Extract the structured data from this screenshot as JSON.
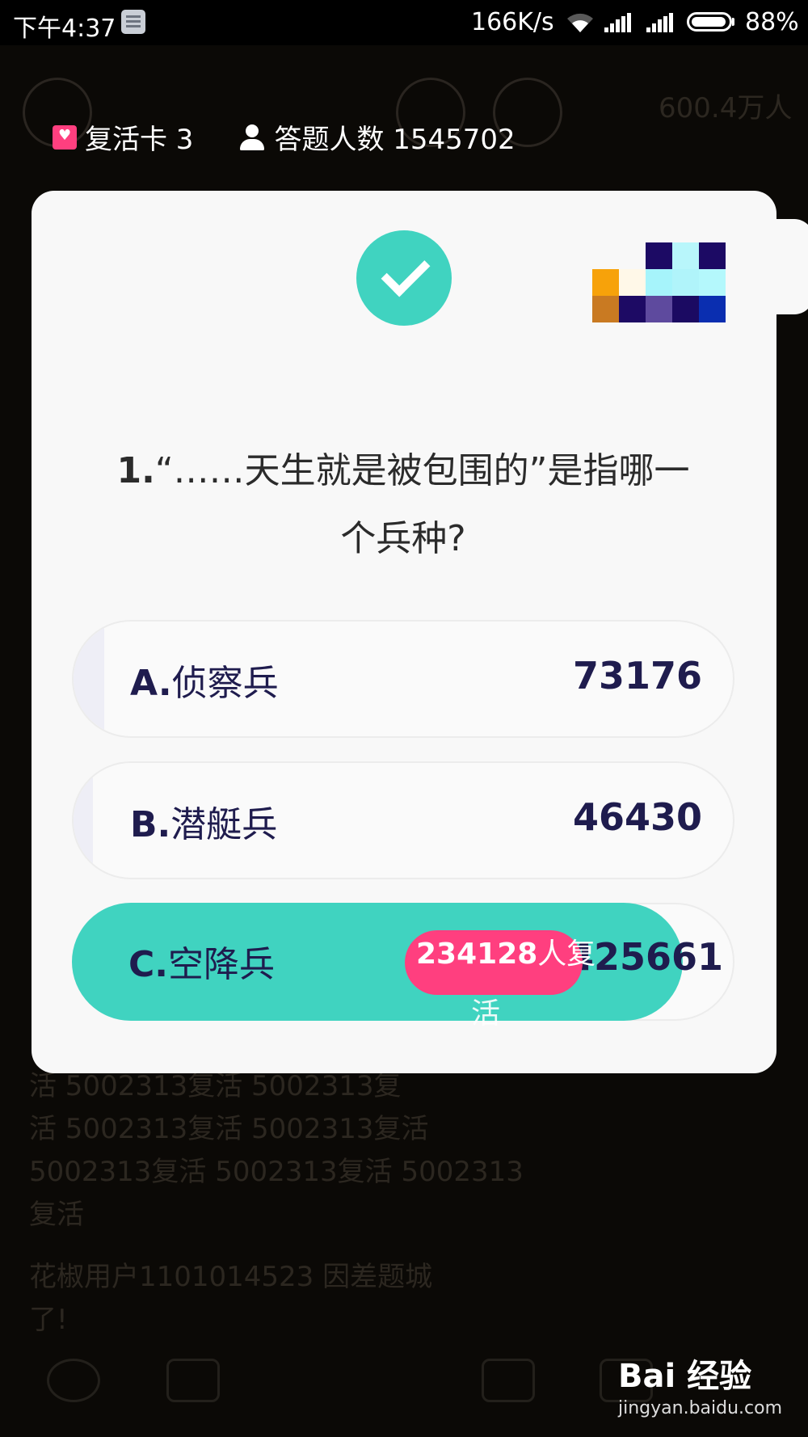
{
  "status_bar": {
    "time": "下午4:37",
    "network_speed": "166K/s",
    "battery": "88%"
  },
  "top_labels": {
    "revive_label": "复活卡 3",
    "participants_label": "答题人数 1545702"
  },
  "background": {
    "top_right_count": "600.4万人",
    "chat_lines": [
      "活   5002313复活   5002313复",
      "活   5002313复活   5002313复活",
      "5002313复活   5002313复活  5002313",
      "复活",
      "        花椒用户1101014523 因差题城",
      "了!"
    ]
  },
  "question": {
    "number": "1.",
    "text": "“……天生就是被包围的”是指哪一个兵种?",
    "status": "correct"
  },
  "options": [
    {
      "letter": "A.",
      "text": "侦察兵",
      "count": "73176",
      "fill_fraction": 0.047
    },
    {
      "letter": "B.",
      "text": "潜艇兵",
      "count": "46430",
      "fill_fraction": 0.03
    }
  ],
  "correct_option": {
    "letter": "C.",
    "text": "空降兵",
    "count": "1425661",
    "fill_fraction": 0.922,
    "revive_number": "234128",
    "revive_suffix": "人复",
    "revive_suffix_line2": "活"
  },
  "watermark": {
    "logo": "Bai 经验",
    "url": "jingyan.baidu.com"
  },
  "colors": {
    "accent_teal": "#40d3c0",
    "accent_pink": "#ff3f7f",
    "text_navy": "#1f1c4e",
    "card_bg": "#f8f8f8"
  },
  "icons": [
    "check-icon",
    "revive-card-icon",
    "user-icon",
    "wifi-icon",
    "signal-icon",
    "battery-icon"
  ]
}
